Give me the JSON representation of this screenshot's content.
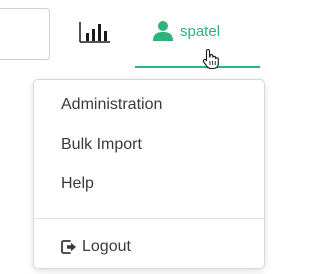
{
  "navbar": {
    "reports_icon": "bar-chart-icon",
    "user": {
      "name": "spatel",
      "icon": "user-icon",
      "accent_color": "#2eb37a"
    }
  },
  "user_menu": {
    "items": [
      {
        "label": "Administration"
      },
      {
        "label": "Bulk Import"
      },
      {
        "label": "Help"
      }
    ],
    "logout": {
      "label": "Logout",
      "icon": "sign-out-icon"
    }
  }
}
